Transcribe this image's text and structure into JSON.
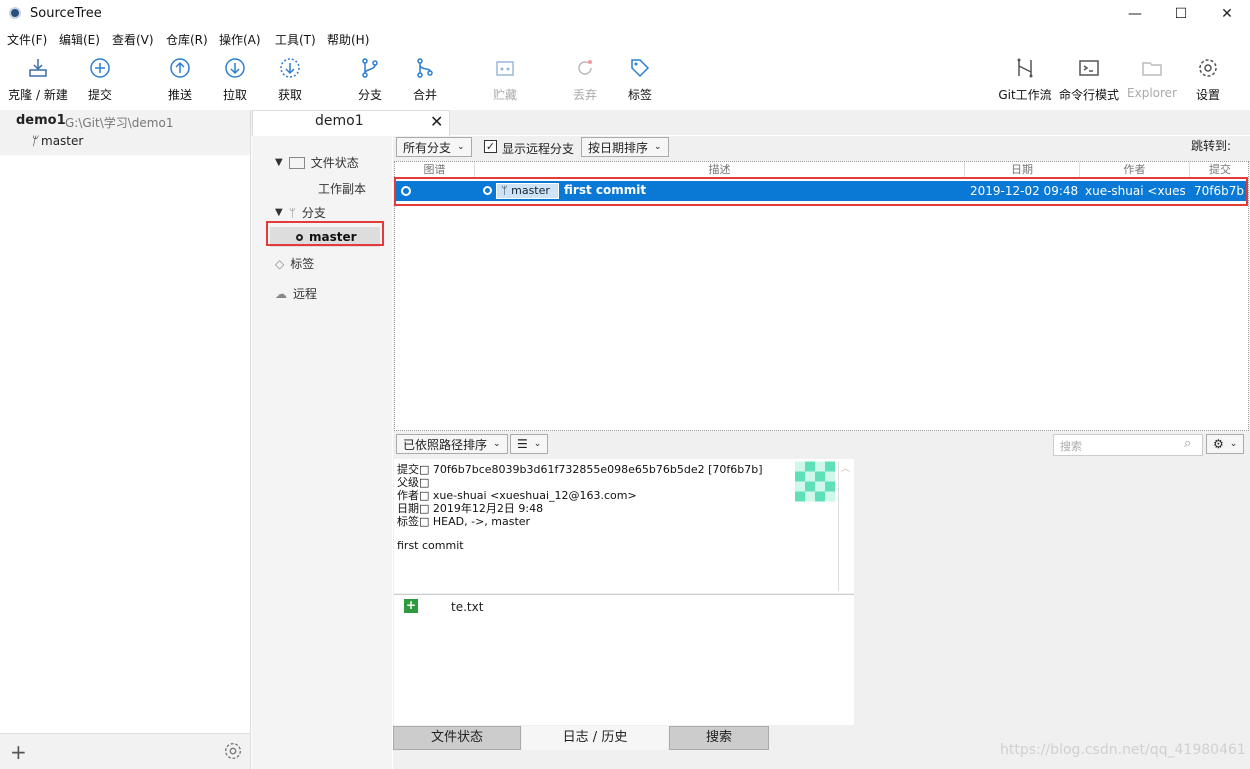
{
  "window": {
    "title": "SourceTree",
    "minimize": "—",
    "maximize": "☐",
    "close": "✕"
  },
  "menu": [
    "文件(F)",
    "编辑(E)",
    "查看(V)",
    "仓库(R)",
    "操作(A)",
    "工具(T)",
    "帮助(H)"
  ],
  "toolbar": {
    "clone": "克隆 / 新建",
    "commit": "提交",
    "push": "推送",
    "pull": "拉取",
    "fetch": "获取",
    "branch": "分支",
    "merge": "合并",
    "stash": "贮藏",
    "discard": "丢弃",
    "tag": "标签",
    "gitflow": "Git工作流",
    "terminal": "命令行模式",
    "explorer": "Explorer",
    "settings": "设置"
  },
  "repo": {
    "name": "demo1",
    "path": "G:\\Git\\学习\\demo1",
    "branch": "master"
  },
  "tab": {
    "title": "demo1",
    "close": "✕"
  },
  "nav": {
    "file_status": "文件状态",
    "working_copy": "工作副本",
    "branches": "分支",
    "master": "master",
    "tags": "标签",
    "remotes": "远程"
  },
  "filters": {
    "branches": "所有分支",
    "show_remote": "显示远程分支",
    "sort": "按日期排序",
    "jump_to": "跳转到:"
  },
  "grid": {
    "headers": [
      "图谱",
      "描述",
      "日期",
      "作者",
      "提交"
    ],
    "commit": {
      "branch_label": "master",
      "message": "first commit",
      "date": "2019-12-02 09:48",
      "author": "xue-shuai <xuesh",
      "hash": "70f6b7b"
    }
  },
  "lower": {
    "sort_path": "已依照路径排序",
    "search_placeholder": "搜索"
  },
  "details": {
    "commit": "提交□ 70f6b7bce8039b3d61f732855e098e65b76b5de2 [70f6b7b]",
    "parent": "父级□",
    "author": "作者□ xue-shuai <xueshuai_12@163.com>",
    "date": "日期□ 2019年12月2日 9:48",
    "tags": "标签□ HEAD, ->, master",
    "message": "first commit"
  },
  "files": [
    {
      "name": "te.txt",
      "status": "added"
    }
  ],
  "bottom_tabs": [
    "文件状态",
    "日志 / 历史",
    "搜索"
  ],
  "left_bottom": {
    "add": "+"
  },
  "watermark": "https://blog.csdn.net/qq_41980461",
  "colors": {
    "selection": "#0a79d6",
    "highlight": "#e53a3a",
    "added": "#2d9a3e"
  }
}
